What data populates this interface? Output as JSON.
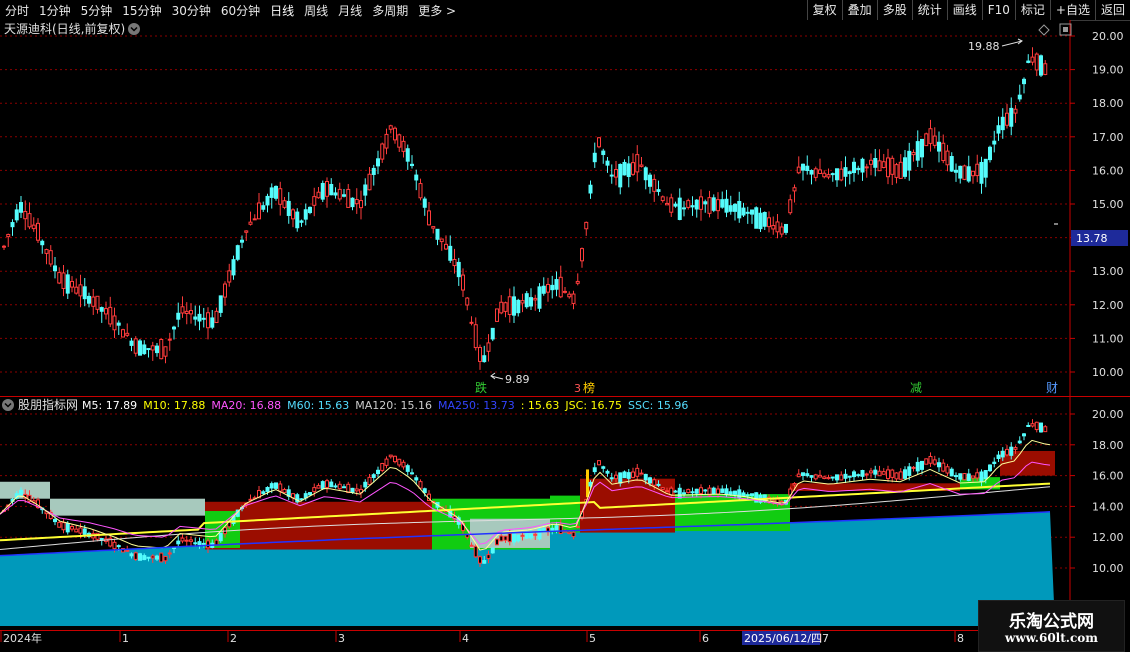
{
  "toolbar": {
    "periods": [
      "分时",
      "1分钟",
      "5分钟",
      "15分钟",
      "30分钟",
      "60分钟",
      "日线",
      "周线",
      "月线",
      "多周期",
      "更多 >"
    ],
    "active_period": "日线",
    "actions": [
      "复权",
      "叠加",
      "多股",
      "统计",
      "画线",
      "F10",
      "标记",
      "+自选",
      "返回"
    ]
  },
  "main_chart": {
    "title": "天源迪科(日线,前复权)",
    "price_axis": [
      "20.00",
      "19.00",
      "18.00",
      "17.00",
      "16.00",
      "15.00",
      "14.00",
      "13.00",
      "12.00",
      "11.00",
      "10.00"
    ],
    "current_price": "13.78",
    "high_label": "19.88",
    "low_label": "9.89",
    "markers": [
      {
        "text": "跌",
        "color": "#33cc33"
      },
      {
        "text": "3",
        "color": "#ff5555"
      },
      {
        "text": "榜",
        "color": "#ffcc00"
      },
      {
        "text": "减",
        "color": "#33cc33"
      },
      {
        "text": "财",
        "color": "#5599ff"
      }
    ]
  },
  "indicator": {
    "name": "股朋指标网",
    "values": [
      {
        "label": "M5: 17.89",
        "color": "#ffffff"
      },
      {
        "label": "M10: 17.88",
        "color": "#ffff00"
      },
      {
        "label": "MA20: 16.88",
        "color": "#ff55ff"
      },
      {
        "label": "M60: 15.63",
        "color": "#55ddff"
      },
      {
        "label": "MA120: 15.16",
        "color": "#cccccc"
      },
      {
        "label": "MA250: 13.73",
        "color": "#3344ff"
      },
      {
        "label": ": 15.63",
        "color": "#ffff00"
      },
      {
        "label": "JSC: 16.75",
        "color": "#ffff00"
      },
      {
        "label": "SSC: 15.96",
        "color": "#55ddff"
      }
    ],
    "price_axis": [
      "20.00",
      "18.00",
      "16.00",
      "14.00",
      "12.00",
      "10.00"
    ]
  },
  "time_axis": {
    "labels": [
      "2024年",
      "1",
      "2",
      "3",
      "4",
      "5",
      "6",
      "7",
      "8"
    ],
    "cursor_date": "2025/06/12/四"
  },
  "watermark": {
    "title": "乐淘公式网",
    "url": "www.60lt.com"
  },
  "colors": {
    "up": "#ff3c3c",
    "down": "#54fcfc",
    "grid": "#8b0000",
    "teal_fill": "#0099bb",
    "red_fill": "#9b0d00",
    "green_fill": "#11cc11"
  }
}
